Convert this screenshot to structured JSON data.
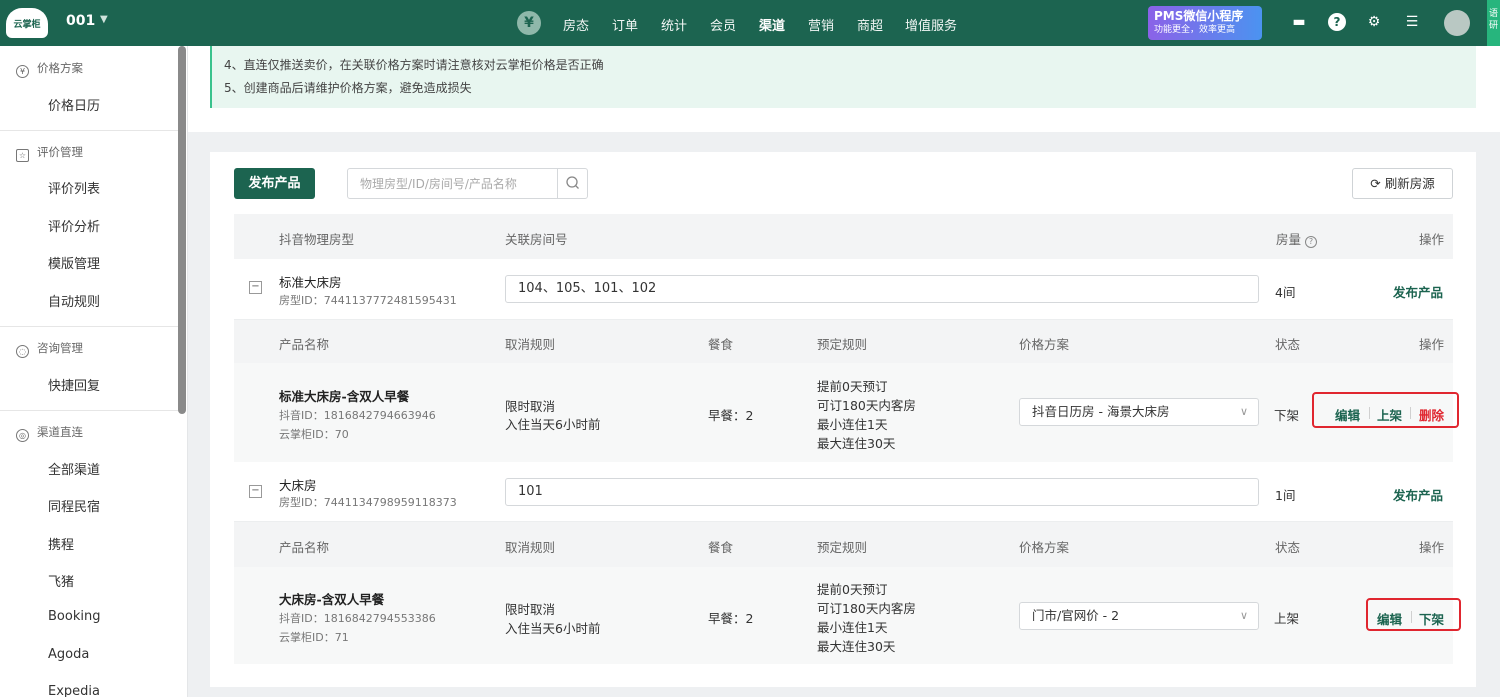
{
  "topbar": {
    "logo": "云掌柜",
    "project": "001",
    "nav": [
      "房态",
      "订单",
      "统计",
      "会员",
      "渠道",
      "营销",
      "商超",
      "增值服务"
    ],
    "active_nav": "渠道",
    "promo_title": "PMS微信小程序",
    "promo_sub": "功能更全，效率更高",
    "edge_text": "语研",
    "icons": [
      "yen-icon",
      "chat-icon",
      "help-icon",
      "gear-icon",
      "menu-icon",
      "avatar"
    ]
  },
  "sidebar": {
    "sections": [
      {
        "title": "价格方案",
        "icon": "yen-circle-icon",
        "items": [
          "价格日历"
        ]
      },
      {
        "title": "评价管理",
        "icon": "star-box-icon",
        "items": [
          "评价列表",
          "评价分析",
          "模版管理",
          "自动规则"
        ]
      },
      {
        "title": "咨询管理",
        "icon": "chat-icon",
        "items": [
          "快捷回复"
        ]
      },
      {
        "title": "渠道直连",
        "icon": "channel-icon",
        "items": [
          "全部渠道",
          "同程民宿",
          "携程",
          "飞猪",
          "Booking",
          "Agoda",
          "Expedia"
        ]
      }
    ]
  },
  "notice": {
    "lines": [
      "4、直连仅推送卖价，在关联价格方案时请注意核对云掌柜价格是否正确",
      "5、创建商品后请维护价格方案，避免造成损失"
    ]
  },
  "toolbar": {
    "publish": "发布产品",
    "search_placeholder": "物理房型/ID/房间号/产品名称",
    "refresh": "刷新房源"
  },
  "room_header": {
    "room_type": "抖音物理房型",
    "room_no": "关联房间号",
    "qty": "房量",
    "op": "操作"
  },
  "product_header": {
    "name": "产品名称",
    "cancel": "取消规则",
    "meal": "餐食",
    "booking": "预定规则",
    "price": "价格方案",
    "status": "状态",
    "op": "操作"
  },
  "rooms": [
    {
      "name": "标准大床房",
      "id_label": "房型ID：7441137772481595431",
      "room_numbers": "104、105、101、102",
      "qty": "4间",
      "publish": "发布产品",
      "product": {
        "name": "标准大床房-含双人早餐",
        "douyin_id": "抖音ID：1816842794663946",
        "yzg_id": "云掌柜ID：70",
        "cancel_1": "限时取消",
        "cancel_2": "入住当天6小时前",
        "meal": "早餐：2",
        "rule_1": "提前0天预订",
        "rule_2": "可订180天内客房",
        "rule_3": "最小连住1天",
        "rule_4": "最大连住30天",
        "price_plan": "抖音日历房 - 海景大床房",
        "status": "下架",
        "actions": [
          "编辑",
          "上架",
          "删除"
        ]
      }
    },
    {
      "name": "大床房",
      "id_label": "房型ID：7441134798959118373",
      "room_numbers": "101",
      "qty": "1间",
      "publish": "发布产品",
      "product": {
        "name": "大床房-含双人早餐",
        "douyin_id": "抖音ID：1816842794553386",
        "yzg_id": "云掌柜ID：71",
        "cancel_1": "限时取消",
        "cancel_2": "入住当天6小时前",
        "meal": "早餐：2",
        "rule_1": "提前0天预订",
        "rule_2": "可订180天内客房",
        "rule_3": "最小连住1天",
        "rule_4": "最大连住30天",
        "price_plan": "门市/官网价 - 2",
        "status": "上架",
        "actions": [
          "编辑",
          "下架"
        ]
      }
    }
  ],
  "colors": {
    "brand": "#1c6450",
    "danger": "#e0262f",
    "notice_bg": "#e8f6f0"
  }
}
